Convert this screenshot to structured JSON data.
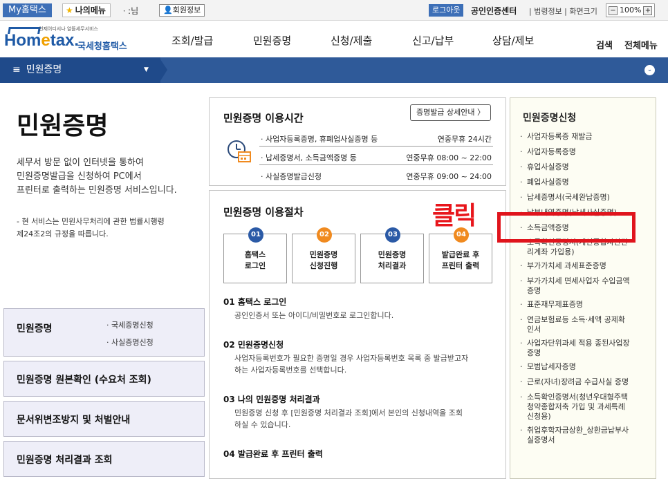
{
  "topbar": {
    "my_hometax": "My홈택스",
    "my_menu": "나의메뉴",
    "user_name": "ㆍ:님",
    "member_info": "회원정보",
    "logout": "로그아웃",
    "cert_center": "공인인증센터",
    "legal_info": "법령정보",
    "screen_size": "화면크기",
    "zoom": "100%",
    "zoom_minus": "−",
    "zoom_plus": "+"
  },
  "header": {
    "logo_sub": "언제어디서나 알뜰세무서비스",
    "logo_main_1": "Hom",
    "logo_main_e": "e",
    "logo_main_2": "tax.",
    "logo_kr": "국세청홈택스",
    "menu": [
      "조회/발급",
      "민원증명",
      "신청/제출",
      "신고/납부",
      "상담/제보"
    ],
    "search": "검색",
    "all_menu": "전체메뉴"
  },
  "nav": {
    "current": "민원증명"
  },
  "page": {
    "title": "민원증명",
    "desc": [
      "세무서 방문 없이 인터넷을 통하여",
      "민원증명발급을 신청하여 PC에서",
      "프린터로 출력하는 민원증명 서비스입니다."
    ],
    "note": [
      "- 현 서비스는 민원사무처리에 관한 법률시행령",
      "  제24조2의 규정을 따릅니다."
    ]
  },
  "left_menu": {
    "item1": "민원증명",
    "item1_subs": [
      "· 국세증명신청",
      "· 사실증명신청"
    ],
    "item2": "민원증명 원본확인 (수요처 조회)",
    "item3": "문서위변조방지 및 처벌안내",
    "item4": "민원증명 처리결과 조회"
  },
  "hours": {
    "title": "민원증명 이용시간",
    "detail_button": "증명발급 상세안내 〉",
    "rows": [
      {
        "name": "· 사업자등록증명, 휴폐업사실증명 등",
        "time": "연중무휴 24시간"
      },
      {
        "name": "· 납세증명서, 소득금액증명 등",
        "time": "연중무휴 08:00 ~ 22:00"
      },
      {
        "name": "· 사실증명발급신청",
        "time": "연중무휴 09:00 ~ 24:00"
      }
    ]
  },
  "procedure": {
    "title": "민원증명 이용절차",
    "click_label": "클릭",
    "steps": [
      {
        "num": "01",
        "line1": "홈택스",
        "line2": "로그인",
        "color": "#2b5aa6"
      },
      {
        "num": "02",
        "line1": "민원증명",
        "line2": "신청진행",
        "color": "#f08a1f"
      },
      {
        "num": "03",
        "line1": "민원증명",
        "line2": "처리결과",
        "color": "#2b5aa6"
      },
      {
        "num": "04",
        "line1": "발급완료 후",
        "line2": "프린터 출력",
        "color": "#f08a1f"
      }
    ],
    "sections": [
      {
        "head": "01 홈택스 로그인",
        "lines": [
          "공인인증서 또는 아이디/비밀번호로 로그인합니다."
        ]
      },
      {
        "head": "02 민원증명신청",
        "lines": [
          "사업자등록번호가 필요한 증명일 경우 사업자등록번호 목록 중 발급받고자",
          "하는 사업자등록번호를 선택합니다."
        ]
      },
      {
        "head": "03 나의 민원증명 처리결과",
        "lines": [
          "민원증명 신청 후 [민원증명 처리결과 조회]에서 본인의 신청내역을 조회",
          "하실 수 있습니다."
        ]
      },
      {
        "head": "04 발급완료 후 프린터 출력",
        "lines": []
      }
    ]
  },
  "sidebar": {
    "title": "민원증명신청",
    "items": [
      [
        "사업자등록증 재발급"
      ],
      [
        "사업자등록증명"
      ],
      [
        "휴업사실증명"
      ],
      [
        "폐업사실증명"
      ],
      [
        "납세증명서(국세완납증명)"
      ],
      [
        "납부내역증명(납세사실증명)"
      ],
      [
        "소득금액증명"
      ],
      [
        "소득확인증명서(개인종합자산관",
        "리계좌 가입용)"
      ],
      [
        "부가가치세 과세표준증명"
      ],
      [
        "부가가치세 면세사업자 수입금액",
        "증명"
      ],
      [
        "표준재무제표증명"
      ],
      [
        "연금보험료등 소득·세액 공제확",
        "인서"
      ],
      [
        "사업자단위과세 적용 종된사업장",
        "증명"
      ],
      [
        "모범납세자증명"
      ],
      [
        "근로(자녀)장려금 수급사실 증명"
      ],
      [
        "소득확인증명서(청년우대형주택",
        "청약종합저축 가입 및 과세특례",
        "신청용)"
      ],
      [
        "취업후학자금상환_상환금납부사",
        "실증명서"
      ]
    ]
  }
}
